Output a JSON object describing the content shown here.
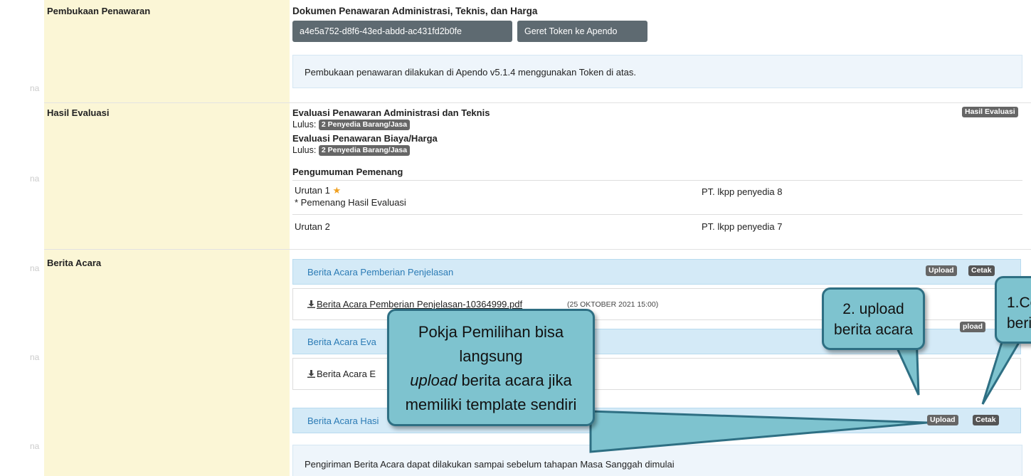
{
  "ghost_char": "na",
  "pembukaan": {
    "label": "Pembukaan Penawaran",
    "doc_title": "Dokumen Penawaran Administrasi, Teknis, dan Harga",
    "token": "a4e5a752-d8f6-43ed-abdd-ac431fd2b0fe",
    "send_token_button": "Geret Token ke Apendo",
    "info": "Pembukaan penawaran dilakukan di Apendo v5.1.4 menggunakan Token di atas."
  },
  "hasil": {
    "label": "Hasil Evaluasi",
    "badge": "Hasil Evaluasi",
    "eval1_title": "Evaluasi Penawaran Administrasi dan Teknis",
    "lulus_label": "Lulus:",
    "eval1_tag": "2 Penyedia Barang/Jasa",
    "eval2_title": "Evaluasi Penawaran Biaya/Harga",
    "eval2_tag": "2 Penyedia Barang/Jasa",
    "pengumuman": "Pengumuman Pemenang",
    "rows": [
      {
        "rank": "Urutan 1",
        "star": "★",
        "note": "* Pemenang Hasil Evaluasi",
        "vendor": "PT. lkpp penyedia 8"
      },
      {
        "rank": "Urutan 2",
        "vendor": "PT. lkpp penyedia 7"
      }
    ]
  },
  "berita": {
    "label": "Berita Acara",
    "upload": "Upload",
    "cetak": "Cetak",
    "sections": [
      {
        "title": "Berita Acara Pemberian Penjelasan",
        "file": "Berita Acara Pemberian Penjelasan-10364999.pdf",
        "date": "(25 OKTOBER 2021 15:00)"
      },
      {
        "title": "Berita Acara Eva",
        "file": "Berita Acara E"
      },
      {
        "title": "Berita Acara Hasi"
      }
    ],
    "upload_partial": "pload",
    "footer": "Pengiriman Berita Acara dapat dilakukan sampai sebelum tahapan Masa Sanggah dimulai"
  },
  "callouts": {
    "main_line1": "Pokja Pemilihan bisa langsung",
    "main_line2_em": "upload",
    "main_line2_rest": " berita acara jika",
    "main_line3": "memiliki template sendiri",
    "upload_line1": "2. upload",
    "upload_line2": "berita acara",
    "cetak_line1": "1.Ce",
    "cetak_line2": "berit"
  }
}
